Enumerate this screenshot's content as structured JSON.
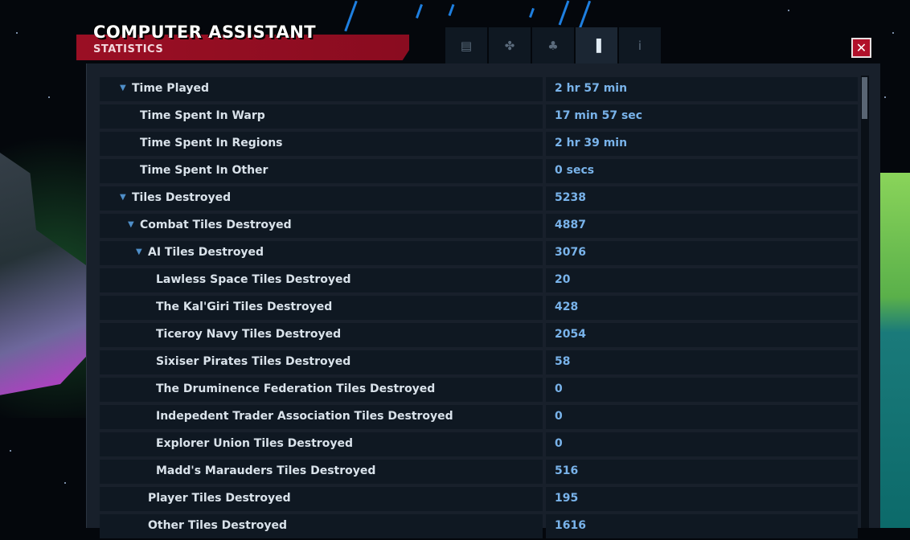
{
  "header": {
    "title": "COMPUTER ASSISTANT",
    "subtitle": "STATISTICS",
    "close_label": "✕",
    "tabs": [
      {
        "icon": "document-icon",
        "glyph": "▤",
        "active": false
      },
      {
        "icon": "handshake-icon",
        "glyph": "✤",
        "active": false
      },
      {
        "icon": "factions-icon",
        "glyph": "♣",
        "active": false
      },
      {
        "icon": "bar-chart-icon",
        "glyph": "▐",
        "active": true
      },
      {
        "icon": "info-icon",
        "glyph": "i",
        "active": false
      }
    ]
  },
  "stats": [
    {
      "label": "Time Played",
      "value": "2 hr 57 min",
      "level": 0,
      "expandable": true
    },
    {
      "label": "Time Spent In Warp",
      "value": "17 min 57 sec",
      "level": 1,
      "expandable": false
    },
    {
      "label": "Time Spent In Regions",
      "value": "2 hr 39 min",
      "level": 1,
      "expandable": false
    },
    {
      "label": "Time Spent In Other",
      "value": "0 secs",
      "level": 1,
      "expandable": false
    },
    {
      "label": "Tiles Destroyed",
      "value": "5238",
      "level": 0,
      "expandable": true
    },
    {
      "label": "Combat Tiles Destroyed",
      "value": "4887",
      "level": 1,
      "expandable": true
    },
    {
      "label": "AI Tiles Destroyed",
      "value": "3076",
      "level": 2,
      "expandable": true
    },
    {
      "label": "Lawless Space Tiles Destroyed",
      "value": "20",
      "level": 3,
      "expandable": false
    },
    {
      "label": "The Kal'Giri Tiles Destroyed",
      "value": "428",
      "level": 3,
      "expandable": false
    },
    {
      "label": "Ticeroy Navy Tiles Destroyed",
      "value": "2054",
      "level": 3,
      "expandable": false
    },
    {
      "label": "Sixiser Pirates Tiles Destroyed",
      "value": "58",
      "level": 3,
      "expandable": false
    },
    {
      "label": "The Druminence Federation Tiles Destroyed",
      "value": "0",
      "level": 3,
      "expandable": false
    },
    {
      "label": "Indepedent Trader Association Tiles Destroyed",
      "value": "0",
      "level": 3,
      "expandable": false
    },
    {
      "label": "Explorer Union Tiles Destroyed",
      "value": "0",
      "level": 3,
      "expandable": false
    },
    {
      "label": "Madd's Marauders Tiles Destroyed",
      "value": "516",
      "level": 3,
      "expandable": false
    },
    {
      "label": "Player Tiles Destroyed",
      "value": "195",
      "level": 2,
      "expandable": false
    },
    {
      "label": "Other Tiles Destroyed",
      "value": "1616",
      "level": 2,
      "expandable": false
    }
  ],
  "colors": {
    "accent_red": "#9a0f24",
    "value_blue": "#79b3ea",
    "label_text": "#d9e2ea",
    "panel_bg": "#18202b",
    "cell_bg": "#0f1822"
  }
}
